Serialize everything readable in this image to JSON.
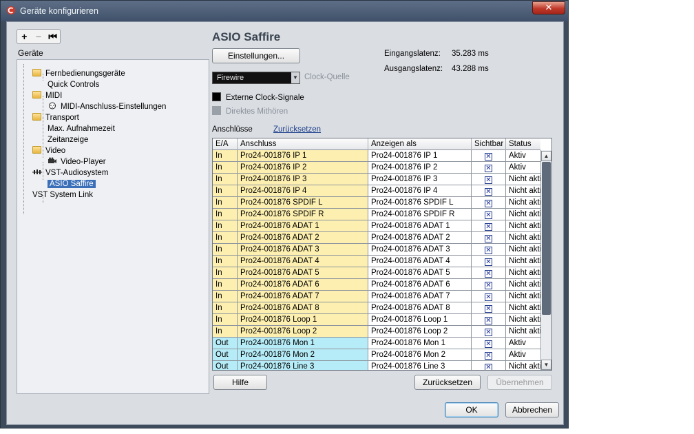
{
  "window": {
    "title": "Geräte konfigurieren",
    "close_label": "✕"
  },
  "tree": {
    "toolbar": {
      "add": "+",
      "remove": "−",
      "reset": "⏮"
    },
    "header": "Geräte",
    "items": [
      {
        "label": "Fernbedienungsgeräte",
        "type": "folder"
      },
      {
        "label": "Quick Controls",
        "type": "leaf"
      },
      {
        "label": "MIDI",
        "type": "folder"
      },
      {
        "label": "MIDI-Anschluss-Einstellungen",
        "type": "leaf"
      },
      {
        "label": "Transport",
        "type": "folder"
      },
      {
        "label": "Max. Aufnahmezeit",
        "type": "leaf"
      },
      {
        "label": "Zeitanzeige",
        "type": "leaf"
      },
      {
        "label": "Video",
        "type": "folder"
      },
      {
        "label": "Video-Player",
        "type": "leaf"
      },
      {
        "label": "VST-Audiosystem",
        "type": "folder"
      },
      {
        "label": "ASIO Saffire",
        "type": "leaf"
      },
      {
        "label": "VST System Link",
        "type": "leaf"
      }
    ]
  },
  "device": {
    "title": "ASIO Saffire",
    "settings_button": "Einstellungen...",
    "input_latency_label": "Eingangslatenz:",
    "input_latency_value": "35.283 ms",
    "output_latency_label": "Ausgangslatenz:",
    "output_latency_value": "43.288 ms",
    "clock_source_value": "Firewire",
    "clock_source_label": "Clock-Quelle",
    "external_clock_label": "Externe Clock-Signale",
    "direct_monitoring_label": "Direktes Mithören",
    "connections_label": "Anschlüsse",
    "reset_link": "Zurücksetzen"
  },
  "table": {
    "headers": [
      "E/A",
      "Anschluss",
      "Anzeigen als",
      "Sichtbar",
      "Status"
    ],
    "rows": [
      {
        "io": "In",
        "port": "Pro24-001876 IP 1",
        "display": "Pro24-001876 IP 1",
        "visible": "✕",
        "status": "Aktiv"
      },
      {
        "io": "In",
        "port": "Pro24-001876 IP 2",
        "display": "Pro24-001876 IP 2",
        "visible": "✕",
        "status": "Aktiv"
      },
      {
        "io": "In",
        "port": "Pro24-001876 IP 3",
        "display": "Pro24-001876 IP 3",
        "visible": "✕",
        "status": "Nicht akti"
      },
      {
        "io": "In",
        "port": "Pro24-001876 IP 4",
        "display": "Pro24-001876 IP 4",
        "visible": "✕",
        "status": "Nicht akti"
      },
      {
        "io": "In",
        "port": "Pro24-001876 SPDIF L",
        "display": "Pro24-001876 SPDIF L",
        "visible": "✕",
        "status": "Nicht akti"
      },
      {
        "io": "In",
        "port": "Pro24-001876 SPDIF R",
        "display": "Pro24-001876 SPDIF R",
        "visible": "✕",
        "status": "Nicht akti"
      },
      {
        "io": "In",
        "port": "Pro24-001876 ADAT 1",
        "display": "Pro24-001876 ADAT 1",
        "visible": "✕",
        "status": "Nicht akti"
      },
      {
        "io": "In",
        "port": "Pro24-001876 ADAT 2",
        "display": "Pro24-001876 ADAT 2",
        "visible": "✕",
        "status": "Nicht akti"
      },
      {
        "io": "In",
        "port": "Pro24-001876 ADAT 3",
        "display": "Pro24-001876 ADAT 3",
        "visible": "✕",
        "status": "Nicht akti"
      },
      {
        "io": "In",
        "port": "Pro24-001876 ADAT 4",
        "display": "Pro24-001876 ADAT 4",
        "visible": "✕",
        "status": "Nicht akti"
      },
      {
        "io": "In",
        "port": "Pro24-001876 ADAT 5",
        "display": "Pro24-001876 ADAT 5",
        "visible": "✕",
        "status": "Nicht akti"
      },
      {
        "io": "In",
        "port": "Pro24-001876 ADAT 6",
        "display": "Pro24-001876 ADAT 6",
        "visible": "✕",
        "status": "Nicht akti"
      },
      {
        "io": "In",
        "port": "Pro24-001876 ADAT 7",
        "display": "Pro24-001876 ADAT 7",
        "visible": "✕",
        "status": "Nicht akti"
      },
      {
        "io": "In",
        "port": "Pro24-001876 ADAT 8",
        "display": "Pro24-001876 ADAT 8",
        "visible": "✕",
        "status": "Nicht akti"
      },
      {
        "io": "In",
        "port": "Pro24-001876 Loop 1",
        "display": "Pro24-001876 Loop 1",
        "visible": "✕",
        "status": "Nicht akti"
      },
      {
        "io": "In",
        "port": "Pro24-001876 Loop 2",
        "display": "Pro24-001876 Loop 2",
        "visible": "✕",
        "status": "Nicht akti"
      },
      {
        "io": "Out",
        "port": "Pro24-001876 Mon 1",
        "display": "Pro24-001876 Mon 1",
        "visible": "✕",
        "status": "Aktiv"
      },
      {
        "io": "Out",
        "port": "Pro24-001876 Mon 2",
        "display": "Pro24-001876 Mon 2",
        "visible": "✕",
        "status": "Aktiv"
      },
      {
        "io": "Out",
        "port": "Pro24-001876 Line 3",
        "display": "Pro24-001876 Line 3",
        "visible": "✕",
        "status": "Nicht akti"
      }
    ]
  },
  "buttons": {
    "help": "Hilfe",
    "reset": "Zurücksetzen",
    "apply": "Übernehmen",
    "ok": "OK",
    "cancel": "Abbrechen"
  },
  "colors": {
    "input_row": "#fcefaf",
    "output_row": "#b6ecf7",
    "selection": "#3b6fb8"
  }
}
